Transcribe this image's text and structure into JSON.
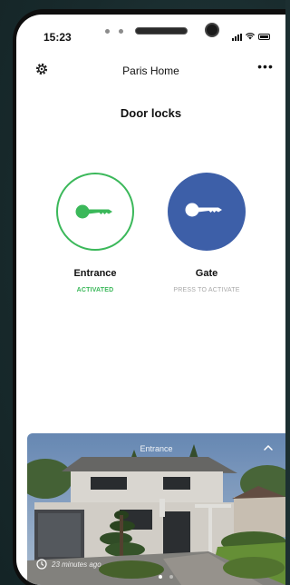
{
  "status_bar": {
    "time": "15:23"
  },
  "header": {
    "home_name": "Paris Home",
    "more_label": "•••"
  },
  "page": {
    "title": "Door locks"
  },
  "locks": [
    {
      "name": "Entrance",
      "status": "ACTIVATED",
      "state": "activated",
      "icon": "key-icon",
      "color": "#3bb85a"
    },
    {
      "name": "Gate",
      "status": "PRESS TO ACTIVATE",
      "state": "inactive",
      "icon": "key-icon",
      "color": "#3d5fa8"
    }
  ],
  "camera": {
    "label": "Entrance",
    "last_update": "23 minutes ago",
    "pages": 2,
    "active_page": 1
  },
  "colors": {
    "accent_green": "#3bb85a",
    "accent_blue": "#3d5fa8",
    "background": "#1c2f31"
  }
}
